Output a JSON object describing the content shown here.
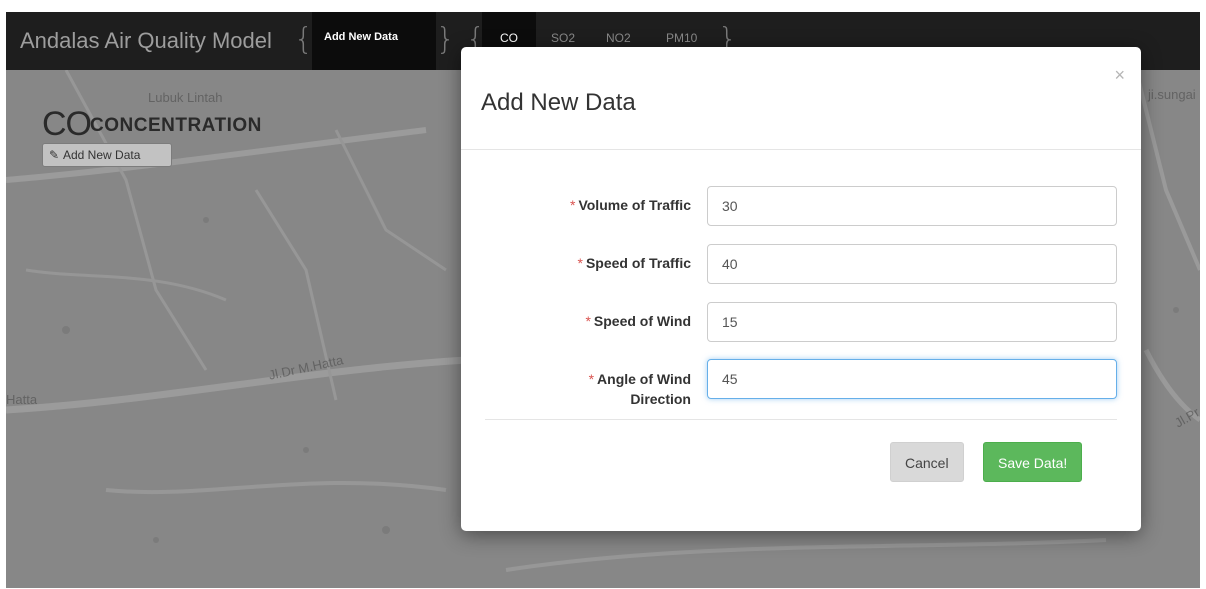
{
  "navbar": {
    "brand": "Andalas Air Quality Model",
    "brace_open": "{",
    "brace_close": "}",
    "add_new_data": "Add New Data",
    "pollutants": [
      "CO",
      "SO2",
      "NO2",
      "PM10"
    ]
  },
  "page": {
    "co_big": "CO",
    "co_sub": "CONCENTRATION",
    "add_button_label": "Add New Data"
  },
  "map_labels": [
    "Lubuk Lintah",
    "Jl.Dr M.Hatta",
    "Hatta",
    "ji.sungai",
    "Jl.Pr"
  ],
  "modal": {
    "title": "Add New Data",
    "close_symbol": "×",
    "fields": [
      {
        "label": "Volume of Traffic",
        "value": "30"
      },
      {
        "label": "Speed of Traffic",
        "value": "40"
      },
      {
        "label": "Speed of Wind",
        "value": "15"
      },
      {
        "label": "Angle of Wind",
        "label_line2": "Direction",
        "value": "45"
      }
    ],
    "required_mark": "*",
    "cancel_label": "Cancel",
    "save_label": "Save Data!"
  },
  "colors": {
    "navbar_bg": "#1e1e1e",
    "save_button": "#5cb85c",
    "required": "#d9534f",
    "focus_border": "#66afe9"
  }
}
